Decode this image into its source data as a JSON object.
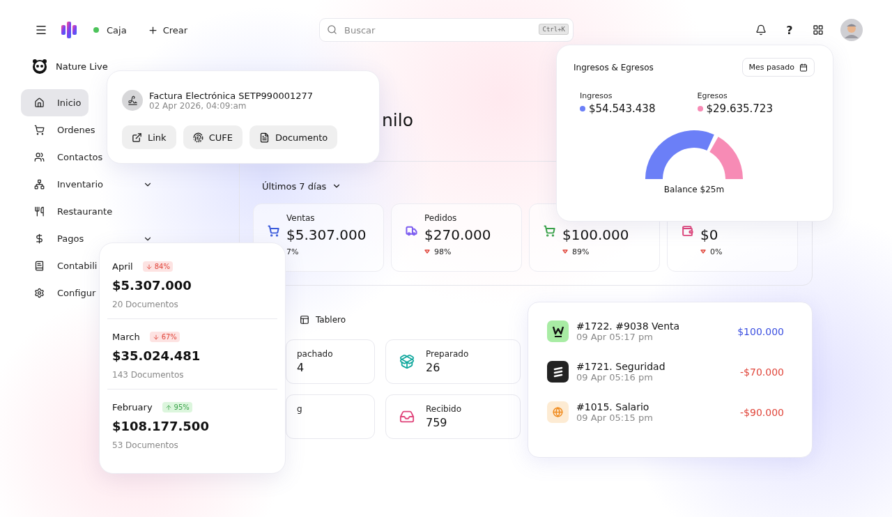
{
  "header": {
    "store": "Caja",
    "store_online": true,
    "create": "Crear",
    "search": {
      "placeholder": "Buscar",
      "shortcut": "Ctrl+K"
    },
    "help": "?"
  },
  "sidebar": {
    "company": "Nature Live",
    "items": [
      {
        "label": "Inicio",
        "selected": true
      },
      {
        "label": "Ordenes",
        "selected": false
      },
      {
        "label": "Contactos",
        "selected": false
      },
      {
        "label": "Inventario",
        "selected": false,
        "expandable": true
      },
      {
        "label": "Restaurante",
        "selected": false
      },
      {
        "label": "Pagos",
        "selected": false,
        "expandable": true
      },
      {
        "label": "Contabili",
        "selected": false
      },
      {
        "label": "Configur",
        "selected": false
      }
    ]
  },
  "greeting": "nilo",
  "period": "Últimos 7 días",
  "stats": [
    {
      "label": "Ventas",
      "color": "#3b5bdb",
      "value": "$5.307.000",
      "delta": "7%",
      "delta_icon": false
    },
    {
      "label": "Pedidos",
      "color": "#7c5cf0",
      "value": "$270.000",
      "delta": "98%",
      "delta_icon": true
    },
    {
      "color": "#3aa24a",
      "value": "$100.000",
      "delta": "89%",
      "delta_icon": true
    },
    {
      "color": "#e0457b",
      "value": "$0",
      "delta": "0%",
      "delta_icon": true
    }
  ],
  "board": {
    "title": "Tablero",
    "statuses": [
      {
        "label": "pachado",
        "value": "4"
      },
      {
        "label": "Preparado",
        "value": "26",
        "color": "#13a89e"
      },
      {
        "label": "g"
      },
      {
        "label": "Recibido",
        "value": "759",
        "color": "#e0457b"
      }
    ]
  },
  "transactions": [
    {
      "title": "#1722. #9038 Venta",
      "date": "09 Apr 05:17 pm",
      "amount": "$100.000",
      "color": "#3b4fe0"
    },
    {
      "title": "#1721. Seguridad",
      "date": "09 Apr 05:16 pm",
      "amount": "-$70.000",
      "color": "#e0453a"
    },
    {
      "title": "#1015. Salario",
      "date": "09 Apr 05:15 pm",
      "amount": "-$90.000",
      "color": "#e0453a"
    }
  ],
  "invoice": {
    "title": "Factura Electrónica SETP990001277",
    "date": "02 Apr 2026, 04:09:am",
    "actions": [
      "Link",
      "CUFE",
      "Documento"
    ]
  },
  "cashflow": {
    "title": "Ingresos & Egresos",
    "range": "Mes pasado",
    "legend": [
      {
        "label": "Ingresos",
        "value": "$54.543.438",
        "color": "#6b7ff7"
      },
      {
        "label": "Egresos",
        "value": "$29.635.723",
        "color": "#f78bb5"
      }
    ],
    "balance_label": "Balance",
    "balance": "$25m"
  },
  "months": [
    {
      "month": "April",
      "change": "84%",
      "increase": false,
      "amount": "$5.307.000",
      "documents": "20 Documentos"
    },
    {
      "month": "March",
      "change": "67%",
      "increase": false,
      "amount": "$35.024.481",
      "documents": "143 Documentos"
    },
    {
      "month": "February",
      "change": "95%",
      "increase": true,
      "amount": "$108.177.500",
      "documents": "53 Documentos"
    }
  ]
}
